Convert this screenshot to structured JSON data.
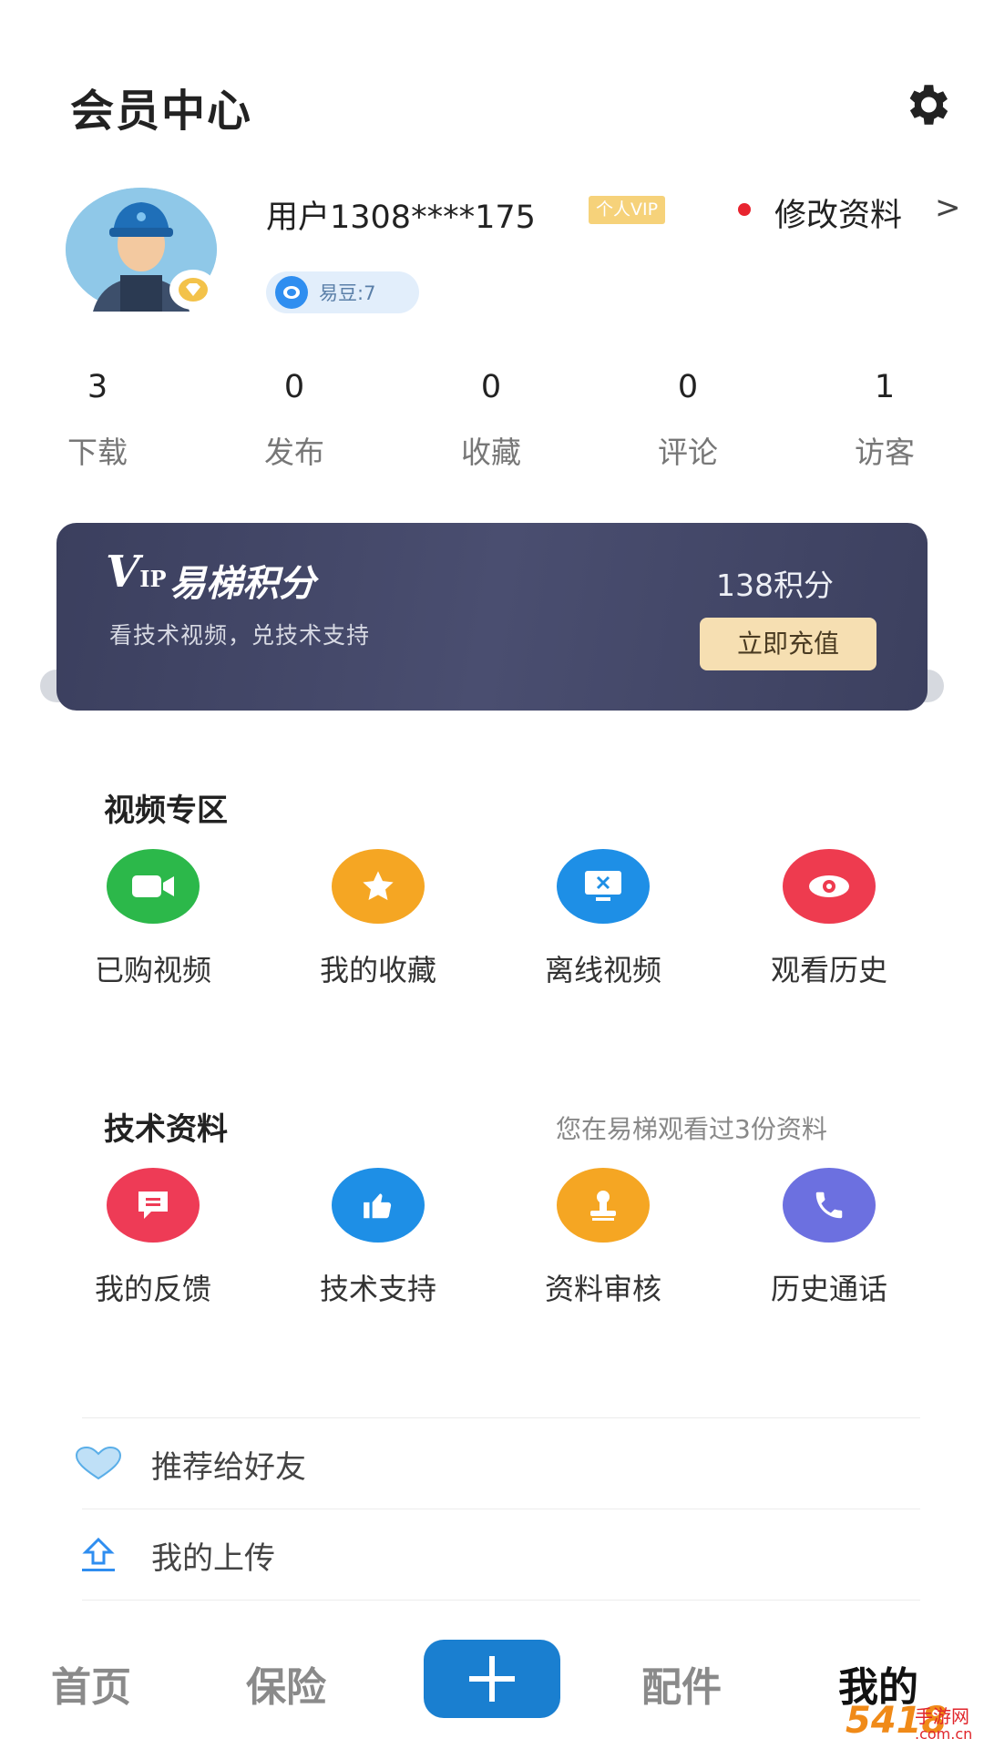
{
  "header": {
    "title": "会员中心",
    "settings_icon": "gear-icon"
  },
  "profile": {
    "username": "用户1308****175",
    "vip_badge": "个人VIP",
    "edit_label": "修改资料",
    "edit_chevron": ">",
    "coins_label": "易豆:7"
  },
  "stats": [
    {
      "value": "3",
      "label": "下载"
    },
    {
      "value": "0",
      "label": "发布"
    },
    {
      "value": "0",
      "label": "收藏"
    },
    {
      "value": "0",
      "label": "评论"
    },
    {
      "value": "1",
      "label": "访客"
    }
  ],
  "vip_card": {
    "logo_v": "V",
    "logo_ip": "IP",
    "title": "易梯积分",
    "subtitle": "看技术视频，兑技术支持",
    "points": "138积分",
    "button": "立即充值"
  },
  "video_section": {
    "title": "视频专区",
    "items": [
      {
        "label": "已购视频",
        "icon": "video-camera-icon",
        "color": "#2cb84a"
      },
      {
        "label": "我的收藏",
        "icon": "star-icon",
        "color": "#f5a623"
      },
      {
        "label": "离线视频",
        "icon": "monitor-icon",
        "color": "#1e8fe6"
      },
      {
        "label": "观看历史",
        "icon": "eye-icon",
        "color": "#ee3b4f"
      }
    ]
  },
  "tech_section": {
    "title": "技术资料",
    "note": "您在易梯观看过3份资料",
    "items": [
      {
        "label": "我的反馈",
        "icon": "message-icon",
        "color": "#ee3b56"
      },
      {
        "label": "技术支持",
        "icon": "thumbs-up-icon",
        "color": "#1e8fe6"
      },
      {
        "label": "资料审核",
        "icon": "stamp-icon",
        "color": "#f5a623"
      },
      {
        "label": "历史通话",
        "icon": "phone-icon",
        "color": "#6c70e0"
      }
    ]
  },
  "list": [
    {
      "label": "推荐给好友",
      "icon": "heart-icon"
    },
    {
      "label": "我的上传",
      "icon": "upload-icon"
    }
  ],
  "nav": {
    "home": "首页",
    "insurance": "保险",
    "parts": "配件",
    "mine": "我的",
    "add_icon": "plus-icon"
  },
  "watermark": {
    "brand": "5418",
    "sub": "手游网",
    "url": ".com.cn"
  }
}
